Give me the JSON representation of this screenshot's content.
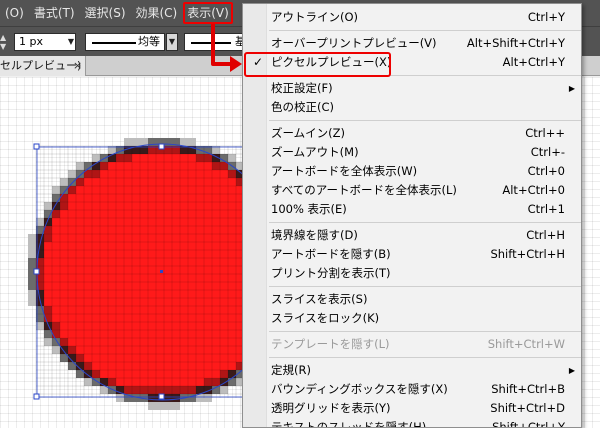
{
  "menubar": {
    "items": [
      {
        "label": "(O)"
      },
      {
        "label": "書式(T)"
      },
      {
        "label": "選択(S)"
      },
      {
        "label": "効果(C)"
      },
      {
        "label": "表示(V)"
      }
    ]
  },
  "control_bar": {
    "stroke_weight": "1 px",
    "profile_label": "均等",
    "brush_label": "基"
  },
  "doc_tab": {
    "title": "セルプレビュー)",
    "close": "×"
  },
  "view_menu": {
    "items": [
      {
        "label": "アウトライン(O)",
        "shortcut": "Ctrl+Y",
        "disabled": false,
        "checked": false
      },
      {
        "sep": true
      },
      {
        "label": "オーバープリントプレビュー(V)",
        "shortcut": "Alt+Shift+Ctrl+Y",
        "disabled": false,
        "checked": false
      },
      {
        "label": "ピクセルプレビュー(X)",
        "shortcut": "Alt+Ctrl+Y",
        "disabled": false,
        "checked": true
      },
      {
        "sep": true
      },
      {
        "label": "校正設定(F)",
        "shortcut": "",
        "submenu": true
      },
      {
        "label": "色の校正(C)",
        "shortcut": ""
      },
      {
        "sep": true
      },
      {
        "label": "ズームイン(Z)",
        "shortcut": "Ctrl++"
      },
      {
        "label": "ズームアウト(M)",
        "shortcut": "Ctrl+-"
      },
      {
        "label": "アートボードを全体表示(W)",
        "shortcut": "Ctrl+0"
      },
      {
        "label": "すべてのアートボードを全体表示(L)",
        "shortcut": "Alt+Ctrl+0"
      },
      {
        "label": "100% 表示(E)",
        "shortcut": "Ctrl+1"
      },
      {
        "sep": true
      },
      {
        "label": "境界線を隠す(D)",
        "shortcut": "Ctrl+H"
      },
      {
        "label": "アートボードを隠す(B)",
        "shortcut": "Shift+Ctrl+H"
      },
      {
        "label": "プリント分割を表示(T)",
        "shortcut": ""
      },
      {
        "sep": true
      },
      {
        "label": "スライスを表示(S)",
        "shortcut": ""
      },
      {
        "label": "スライスをロック(K)",
        "shortcut": ""
      },
      {
        "sep": true
      },
      {
        "label": "テンプレートを隠す(L)",
        "shortcut": "Shift+Ctrl+W",
        "disabled": true
      },
      {
        "sep": true
      },
      {
        "label": "定規(R)",
        "shortcut": "",
        "submenu": true
      },
      {
        "label": "バウンディングボックスを隠す(X)",
        "shortcut": "Shift+Ctrl+B"
      },
      {
        "label": "透明グリッドを表示(Y)",
        "shortcut": "Shift+Ctrl+D"
      },
      {
        "label": "テキストのスレッドを隠す(H)",
        "shortcut": "Shift+Ctrl+Y"
      }
    ],
    "check_glyph": "✓",
    "submenu_glyph": "▶"
  },
  "colors": {
    "circle_fill": "#ff1a1a",
    "highlight": "#e00000",
    "selection": "#2a46c8"
  }
}
